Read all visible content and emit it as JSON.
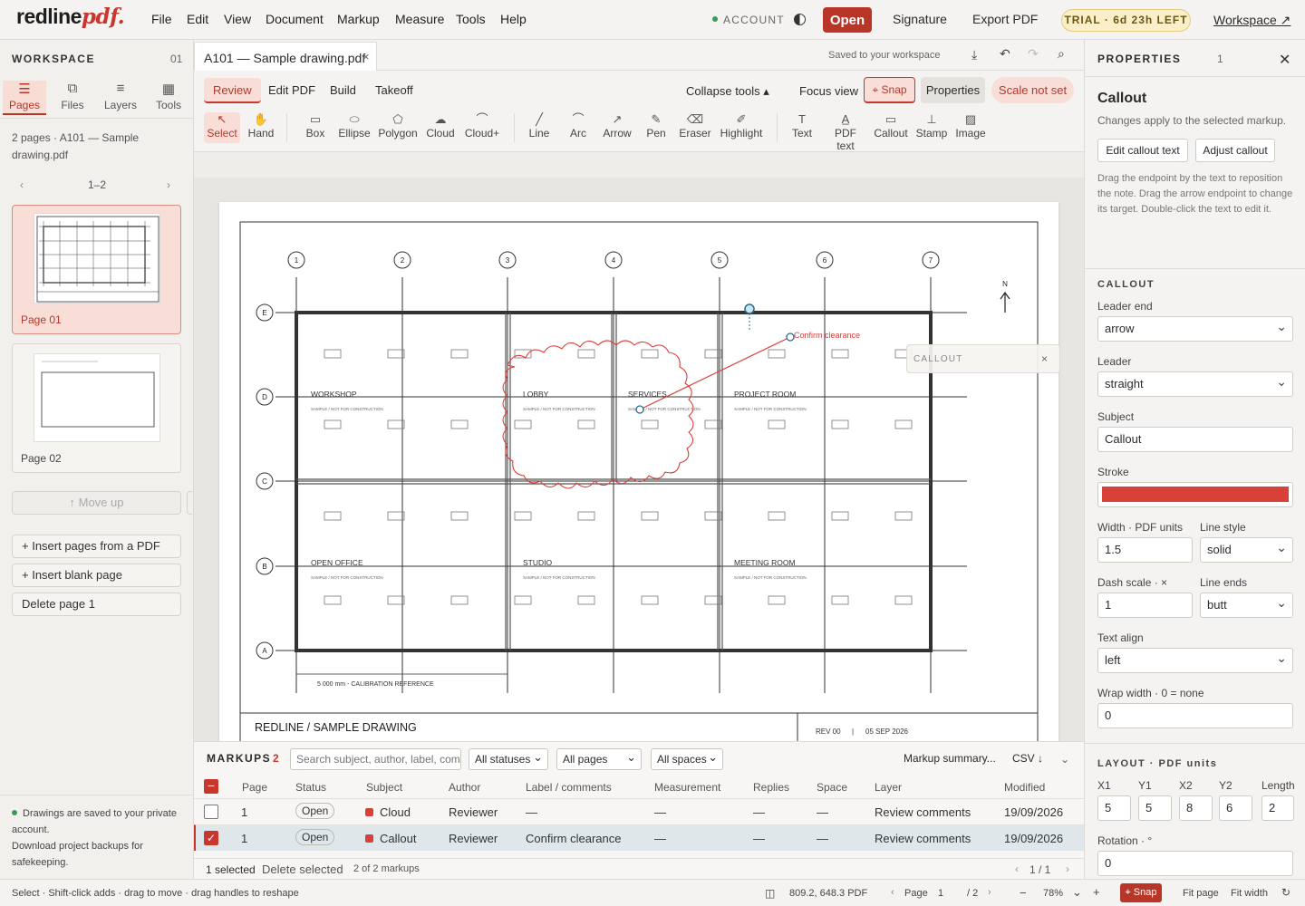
{
  "app": {
    "logo_main": "redline",
    "logo_accent": "pdf."
  },
  "menu": [
    "File",
    "Edit",
    "View",
    "Document",
    "Markup",
    "Measure",
    "Tools",
    "Help"
  ],
  "header": {
    "account": "ACCOUNT",
    "open": "Open",
    "signature": "Signature",
    "export": "Export PDF",
    "trial": "TRIAL · 6d 23h LEFT",
    "workspace": "Workspace ↗"
  },
  "sidebar": {
    "title": "WORKSPACE",
    "count": "01",
    "tabs": [
      {
        "label": "Pages",
        "icon": "pages-icon",
        "glyph": "☰"
      },
      {
        "label": "Files",
        "icon": "files-icon",
        "glyph": "⧉"
      },
      {
        "label": "Layers",
        "icon": "layers-icon",
        "glyph": "≡"
      },
      {
        "label": "Tools",
        "icon": "tools-icon",
        "glyph": "▦"
      }
    ],
    "doc_info": "2 pages · A101 — Sample drawing.pdf",
    "page_range": "1–2",
    "pages": [
      "Page 01",
      "Page 02"
    ],
    "move_up": "↑ Move up",
    "insert_pdf": "+ Insert pages from a PDF",
    "insert_blank": "+ Insert blank page",
    "delete_page": "Delete page 1",
    "note_line1": "Drawings are saved to your private account.",
    "note_line2": "Download project backups for safekeeping."
  },
  "document_tab": {
    "title": "A101 — Sample drawing.pdf",
    "saved": "Saved to your workspace"
  },
  "modes": [
    "Review",
    "Edit PDF",
    "Build",
    "Takeoff"
  ],
  "toolbar_right": {
    "collapse": "Collapse tools ▴",
    "focus": "Focus view",
    "snap": "⌖ Snap",
    "properties": "Properties",
    "scale": "Scale not set"
  },
  "tools": [
    {
      "label": "Select",
      "glyph": "↖",
      "name": "select-tool"
    },
    {
      "label": "Hand",
      "glyph": "✋",
      "name": "hand-tool"
    },
    {
      "label": "Box",
      "glyph": "▭",
      "name": "box-tool"
    },
    {
      "label": "Ellipse",
      "glyph": "⬭",
      "name": "ellipse-tool"
    },
    {
      "label": "Polygon",
      "glyph": "⬠",
      "name": "polygon-tool"
    },
    {
      "label": "Cloud",
      "glyph": "☁",
      "name": "cloud-tool"
    },
    {
      "label": "Cloud+",
      "glyph": "⌒",
      "name": "cloud-plus-tool"
    },
    {
      "label": "Line",
      "glyph": "╱",
      "name": "line-tool"
    },
    {
      "label": "Arc",
      "glyph": "⌒",
      "name": "arc-tool"
    },
    {
      "label": "Arrow",
      "glyph": "↗",
      "name": "arrow-tool"
    },
    {
      "label": "Pen",
      "glyph": "✎",
      "name": "pen-tool"
    },
    {
      "label": "Eraser",
      "glyph": "⌫",
      "name": "eraser-tool"
    },
    {
      "label": "Highlight",
      "glyph": "✐",
      "name": "highlight-tool"
    },
    {
      "label": "Text",
      "glyph": "T",
      "name": "text-tool"
    },
    {
      "label": "PDF text",
      "glyph": "A̲",
      "name": "pdf-text-tool"
    },
    {
      "label": "Callout",
      "glyph": "💬",
      "name": "callout-tool"
    },
    {
      "label": "Stamp",
      "glyph": "⊥",
      "name": "stamp-tool"
    },
    {
      "label": "Image",
      "glyph": "▨",
      "name": "image-tool"
    }
  ],
  "drawing": {
    "grid_cols": [
      "1",
      "2",
      "3",
      "4",
      "5",
      "6",
      "7"
    ],
    "grid_rows": [
      "E",
      "D",
      "C",
      "B",
      "A"
    ],
    "north": "N",
    "rooms": [
      "WORKSHOP",
      "LOBBY",
      "SERVICES",
      "PROJECT ROOM",
      "OPEN OFFICE",
      "STUDIO",
      "MEETING ROOM"
    ],
    "room_note": "SAMPLE / NOT FOR CONSTRUCTION",
    "calibration": "5 000 mm - CALIBRATION REFERENCE",
    "title_block": "REDLINE  /  SAMPLE DRAWING",
    "rev": "REV 00",
    "date": "05 SEP 2026",
    "callout_text": "Confirm clearance",
    "callout_popup": "CALLOUT"
  },
  "markups": {
    "title": "MARKUPS",
    "count": "2",
    "search_placeholder": "Search subject, author, label, comment",
    "statuses": "All statuses",
    "pages": "All pages",
    "spaces": "All spaces",
    "summary": "Markup summary...",
    "csv": "CSV ↓",
    "columns": [
      "Page",
      "Status",
      "Subject",
      "Author",
      "Label / comments",
      "Measurement",
      "Replies",
      "Space",
      "Layer",
      "Modified"
    ],
    "rows": [
      {
        "page": "1",
        "status": "Open",
        "subject": "Cloud",
        "author": "Reviewer",
        "label": "—",
        "measurement": "—",
        "replies": "—",
        "space": "—",
        "layer": "Review comments",
        "modified": "19/09/2026"
      },
      {
        "page": "1",
        "status": "Open",
        "subject": "Callout",
        "author": "Reviewer",
        "label": "Confirm clearance",
        "measurement": "—",
        "replies": "—",
        "space": "—",
        "layer": "Review comments",
        "modified": "19/09/2026"
      }
    ],
    "selected": "1 selected",
    "delete_selected": "Delete selected",
    "of_count": "2 of 2 markups",
    "pager": "1 / 1"
  },
  "properties": {
    "title": "PROPERTIES",
    "count": "1",
    "heading": "Callout",
    "sub": "Changes apply to the selected markup.",
    "edit_text": "Edit callout text",
    "adjust": "Adjust callout",
    "help": "Drag the endpoint by the text to reposition the note. Drag the arrow endpoint to change its target. Double-click the text to edit it.",
    "section_callout": "CALLOUT",
    "leader_end_label": "Leader end",
    "leader_end": "arrow",
    "leader_label": "Leader",
    "leader": "straight",
    "subject_label": "Subject",
    "subject": "Callout",
    "stroke_label": "Stroke",
    "stroke_color": "#d8403a",
    "width_label": "Width · PDF units",
    "width": "1.5",
    "linestyle_label": "Line style",
    "linestyle": "solid",
    "dash_label": "Dash scale · ×",
    "dash": "1",
    "lineends_label": "Line ends",
    "lineends": "butt",
    "textalign_label": "Text align",
    "textalign": "left",
    "wrap_label": "Wrap width · 0 = none",
    "wrap": "0",
    "section_layout": "LAYOUT · PDF units",
    "x1_label": "X1",
    "x1": "5",
    "y1_label": "Y1",
    "y1": "5",
    "x2_label": "X2",
    "x2": "8",
    "y2_label": "Y2",
    "y2": "6",
    "length_label": "Length",
    "length": "2",
    "rotation_label": "Rotation · °",
    "rotation": "0"
  },
  "statusbar": {
    "hint": "Select · Shift-click adds · drag to move · drag handles to reshape",
    "coords": "809.2, 648.3 PDF",
    "page_label": "Page",
    "page": "1",
    "total": "/ 2",
    "zoom": "78%",
    "snap": "⌖ Snap",
    "fit_page": "Fit page",
    "fit_width": "Fit width"
  }
}
